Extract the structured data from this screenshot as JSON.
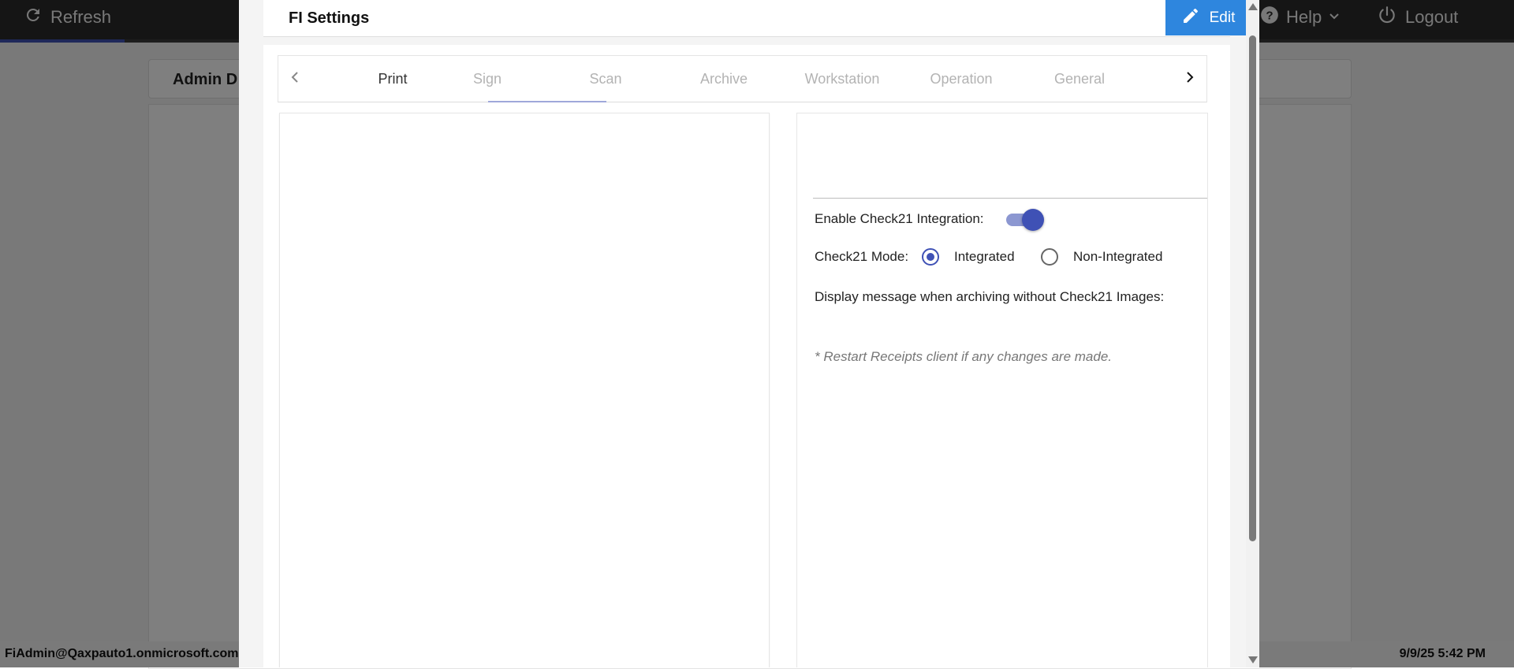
{
  "topbar": {
    "refresh_label": "Refresh",
    "help_label": "Help",
    "logout_label": "Logout"
  },
  "background": {
    "card_title": "Admin D"
  },
  "footer": {
    "user": "FiAdmin@Qaxpauto1.onmicrosoft.com",
    "timestamp": "9/9/25 5:42 PM"
  },
  "dialog": {
    "title": "FI Settings",
    "edit_label": "Edit",
    "tabs": [
      {
        "label": "Print"
      },
      {
        "label": "Sign"
      },
      {
        "label": "Scan"
      },
      {
        "label": "Archive"
      },
      {
        "label": "Workstation"
      },
      {
        "label": "Operation"
      },
      {
        "label": "General"
      }
    ],
    "settings": {
      "check21_integration_label": "Enable Check21 Integration:",
      "check21_integration_enabled": true,
      "check21_mode_label": "Check21 Mode:",
      "check21_mode_options": [
        "Integrated",
        "Non-Integrated"
      ],
      "check21_mode_selected": "Integrated",
      "display_message_label": "Display message when archiving without Check21 Images:",
      "restart_note": "* Restart Receipts client if any changes are made."
    }
  },
  "colors": {
    "accent": "#3f51b5",
    "edit_button": "#2e86de",
    "topbar": "#2b2b2b"
  }
}
